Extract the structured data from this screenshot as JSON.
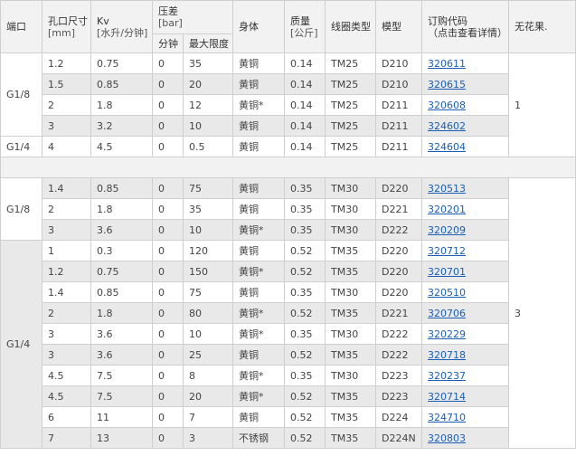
{
  "headers": {
    "port": "端口",
    "orifice_line1": "孔口尺寸",
    "orifice_line2": "[mm]",
    "kv_line1": "Kv",
    "kv_line2": "[水升/分钟]",
    "pressure_line1": "压差",
    "pressure_line2": "[bar]",
    "pressure_min": "分钟",
    "pressure_max": "最大限度",
    "body": "身体",
    "mass_line1": "质量",
    "mass_line2": "[公斤]",
    "coil": "线圈类型",
    "model": "模型",
    "order_line1": "订购代码",
    "order_line2": "（点击查看详情）",
    "no_result": "无花果."
  },
  "groups": [
    {
      "number": "1",
      "sections": [
        {
          "port": "G1/8",
          "rows": [
            {
              "orifice": "1.2",
              "kv": "0.75",
              "pmin": "0",
              "pmax": "35",
              "body": "黄铜",
              "mass": "0.14",
              "coil": "TM25",
              "model": "D210",
              "code": "320611"
            },
            {
              "orifice": "1.5",
              "kv": "0.85",
              "pmin": "0",
              "pmax": "20",
              "body": "黄铜",
              "mass": "0.14",
              "coil": "TM25",
              "model": "D210",
              "code": "320615"
            },
            {
              "orifice": "2",
              "kv": "1.8",
              "pmin": "0",
              "pmax": "12",
              "body": "黄铜*",
              "mass": "0.14",
              "coil": "TM25",
              "model": "D211",
              "code": "320608"
            },
            {
              "orifice": "3",
              "kv": "3.2",
              "pmin": "0",
              "pmax": "10",
              "body": "黄铜",
              "mass": "0.14",
              "coil": "TM25",
              "model": "D211",
              "code": "324602"
            }
          ]
        },
        {
          "port": "G1/4",
          "rows": [
            {
              "orifice": "4",
              "kv": "4.5",
              "pmin": "0",
              "pmax": "0.5",
              "body": "黄铜",
              "mass": "0.14",
              "coil": "TM25",
              "model": "D211",
              "code": "324604"
            }
          ]
        }
      ]
    },
    {
      "number": "3",
      "sections": [
        {
          "port": "G1/8",
          "rows": [
            {
              "orifice": "1.4",
              "kv": "0.85",
              "pmin": "0",
              "pmax": "75",
              "body": "黄铜",
              "mass": "0.35",
              "coil": "TM30",
              "model": "D220",
              "code": "320513"
            },
            {
              "orifice": "2",
              "kv": "1.8",
              "pmin": "0",
              "pmax": "35",
              "body": "黄铜",
              "mass": "0.35",
              "coil": "TM30",
              "model": "D221",
              "code": "320201"
            },
            {
              "orifice": "3",
              "kv": "3.6",
              "pmin": "0",
              "pmax": "10",
              "body": "黄铜*",
              "mass": "0.35",
              "coil": "TM30",
              "model": "D222",
              "code": "320209"
            }
          ]
        },
        {
          "port": "G1/4",
          "rows": [
            {
              "orifice": "1",
              "kv": "0.3",
              "pmin": "0",
              "pmax": "120",
              "body": "黄铜",
              "mass": "0.52",
              "coil": "TM35",
              "model": "D220",
              "code": "320712"
            },
            {
              "orifice": "1.2",
              "kv": "0.75",
              "pmin": "0",
              "pmax": "150",
              "body": "黄铜*",
              "mass": "0.52",
              "coil": "TM35",
              "model": "D220",
              "code": "320701"
            },
            {
              "orifice": "1.4",
              "kv": "0.85",
              "pmin": "0",
              "pmax": "75",
              "body": "黄铜",
              "mass": "0.35",
              "coil": "TM30",
              "model": "D220",
              "code": "320510"
            },
            {
              "orifice": "2",
              "kv": "1.8",
              "pmin": "0",
              "pmax": "80",
              "body": "黄铜*",
              "mass": "0.52",
              "coil": "TM35",
              "model": "D221",
              "code": "320706"
            },
            {
              "orifice": "3",
              "kv": "3.6",
              "pmin": "0",
              "pmax": "10",
              "body": "黄铜*",
              "mass": "0.35",
              "coil": "TM30",
              "model": "D222",
              "code": "320229"
            },
            {
              "orifice": "3",
              "kv": "3.6",
              "pmin": "0",
              "pmax": "25",
              "body": "黄铜",
              "mass": "0.52",
              "coil": "TM35",
              "model": "D222",
              "code": "320718"
            },
            {
              "orifice": "4.5",
              "kv": "7.5",
              "pmin": "0",
              "pmax": "8",
              "body": "黄铜*",
              "mass": "0.35",
              "coil": "TM30",
              "model": "D223",
              "code": "320237"
            },
            {
              "orifice": "4.5",
              "kv": "7.5",
              "pmin": "0",
              "pmax": "20",
              "body": "黄铜*",
              "mass": "0.52",
              "coil": "TM35",
              "model": "D223",
              "code": "320714"
            },
            {
              "orifice": "6",
              "kv": "11",
              "pmin": "0",
              "pmax": "7",
              "body": "黄铜",
              "mass": "0.52",
              "coil": "TM35",
              "model": "D224",
              "code": "324710"
            },
            {
              "orifice": "7",
              "kv": "13",
              "pmin": "0",
              "pmax": "3",
              "body": "不锈钢",
              "mass": "0.52",
              "coil": "TM35",
              "model": "D224N",
              "code": "320803"
            }
          ]
        }
      ]
    }
  ],
  "colors": {
    "header_bg": "#f2f2f2",
    "alt_row_bg": "#e9e9e9",
    "border": "#cfcfcf",
    "link": "#1a5fb4"
  }
}
